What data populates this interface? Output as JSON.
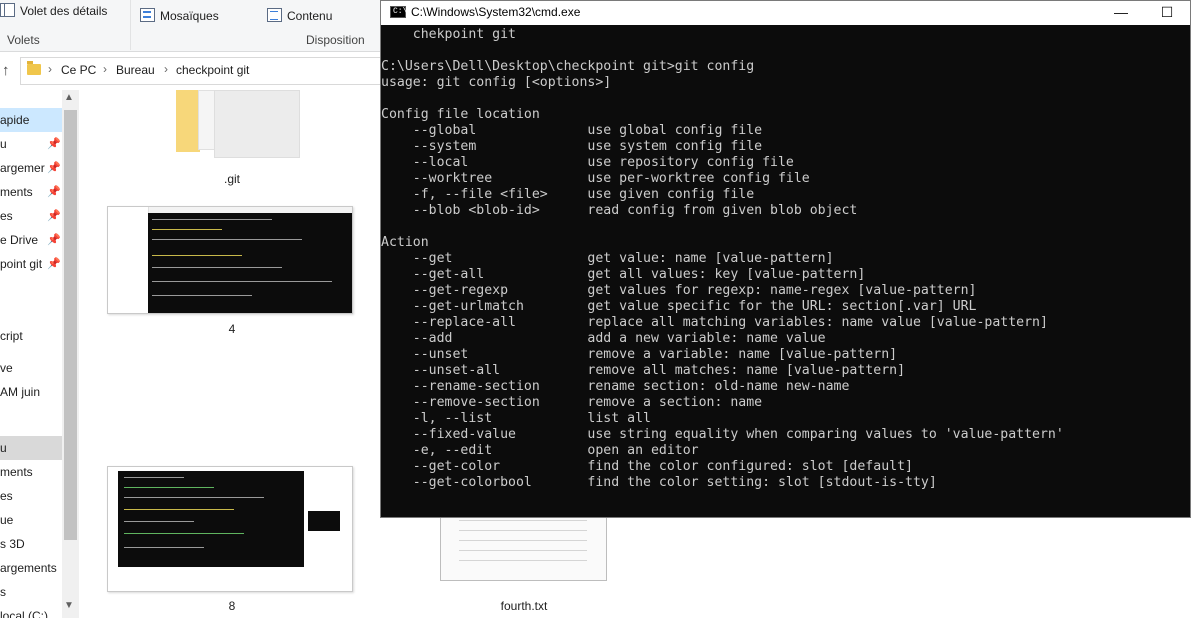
{
  "ribbon": {
    "details_pane": "Volet des détails",
    "tiles": "Mosaïques",
    "content": "Contenu",
    "group_panes": "Volets",
    "group_layout": "Disposition"
  },
  "address": {
    "crumbs": [
      "Ce PC",
      "Bureau",
      "checkpoint git"
    ]
  },
  "nav_pane": {
    "items": [
      {
        "label": "apide",
        "pinned": false
      },
      {
        "label": "u",
        "pinned": true
      },
      {
        "label": "argemer",
        "pinned": true
      },
      {
        "label": "ments",
        "pinned": true
      },
      {
        "label": "es",
        "pinned": true
      },
      {
        "label": "e Drive",
        "pinned": true
      },
      {
        "label": "point git",
        "pinned": true
      },
      {
        "label": "cript",
        "pinned": false
      },
      {
        "label": "ve",
        "pinned": false
      },
      {
        "label": "AM juin",
        "pinned": false
      },
      {
        "label": "u",
        "pinned": false
      },
      {
        "label": "ments",
        "pinned": false
      },
      {
        "label": "es",
        "pinned": false
      },
      {
        "label": "ue",
        "pinned": false
      },
      {
        "label": "s 3D",
        "pinned": false
      },
      {
        "label": "argements",
        "pinned": false
      },
      {
        "label": "s",
        "pinned": false
      },
      {
        "label": "local (C:)",
        "pinned": false
      }
    ]
  },
  "files": {
    "items": [
      "",
      ".git",
      "4",
      "8",
      "fourth.txt"
    ]
  },
  "cmd": {
    "title": "C:\\Windows\\System32\\cmd.exe",
    "icon_text": "C:\\",
    "minimize": "—",
    "maximize": "☐",
    "lines": [
      "    chekpoint git",
      "",
      "C:\\Users\\Dell\\Desktop\\checkpoint git>git config",
      "usage: git config [<options>]",
      "",
      "Config file location",
      "    --global              use global config file",
      "    --system              use system config file",
      "    --local               use repository config file",
      "    --worktree            use per-worktree config file",
      "    -f, --file <file>     use given config file",
      "    --blob <blob-id>      read config from given blob object",
      "",
      "Action",
      "    --get                 get value: name [value-pattern]",
      "    --get-all             get all values: key [value-pattern]",
      "    --get-regexp          get values for regexp: name-regex [value-pattern]",
      "    --get-urlmatch        get value specific for the URL: section[.var] URL",
      "    --replace-all         replace all matching variables: name value [value-pattern]",
      "    --add                 add a new variable: name value",
      "    --unset               remove a variable: name [value-pattern]",
      "    --unset-all           remove all matches: name [value-pattern]",
      "    --rename-section      rename section: old-name new-name",
      "    --remove-section      remove a section: name",
      "    -l, --list            list all",
      "    --fixed-value         use string equality when comparing values to 'value-pattern'",
      "    -e, --edit            open an editor",
      "    --get-color           find the color configured: slot [default]",
      "    --get-colorbool       find the color setting: slot [stdout-is-tty]"
    ]
  }
}
